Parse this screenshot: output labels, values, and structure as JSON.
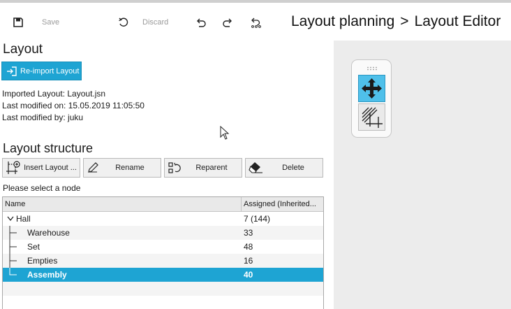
{
  "toolbar": {
    "save_label": "Save",
    "discard_label": "Discard"
  },
  "breadcrumb": {
    "parent": "Layout planning",
    "separator": ">",
    "current": "Layout Editor"
  },
  "layout_section": {
    "title": "Layout",
    "reimport_label": "Re-import Layout",
    "imported": "Imported Layout: Layout.jsn",
    "modified_on": "Last modified on: 15.05.2019 11:05:50",
    "modified_by": "Last modified by: juku"
  },
  "structure": {
    "title": "Layout structure",
    "insert_label": "Insert Layout ...",
    "rename_label": "Rename",
    "reparent_label": "Reparent",
    "delete_label": "Delete",
    "hint": "Please select a node"
  },
  "tree": {
    "col_name": "Name",
    "col_assigned": "Assigned (Inherited...",
    "rows": [
      {
        "name": "Hall",
        "value": "7 (144)"
      },
      {
        "name": "Warehouse",
        "value": "33"
      },
      {
        "name": "Set",
        "value": "48"
      },
      {
        "name": "Empties",
        "value": "16"
      },
      {
        "name": "Assembly",
        "value": "40"
      }
    ]
  },
  "colors": {
    "accent": "#1ea4d3",
    "tool_active": "#4fc0ea"
  },
  "icons": [
    "save-icon",
    "discard-icon",
    "undo-icon",
    "redo-icon",
    "history-icon",
    "import-icon",
    "insert-node-icon",
    "pencil-icon",
    "reparent-icon",
    "eraser-icon",
    "move-icon",
    "crop-icon",
    "mouse-cursor-icon"
  ]
}
